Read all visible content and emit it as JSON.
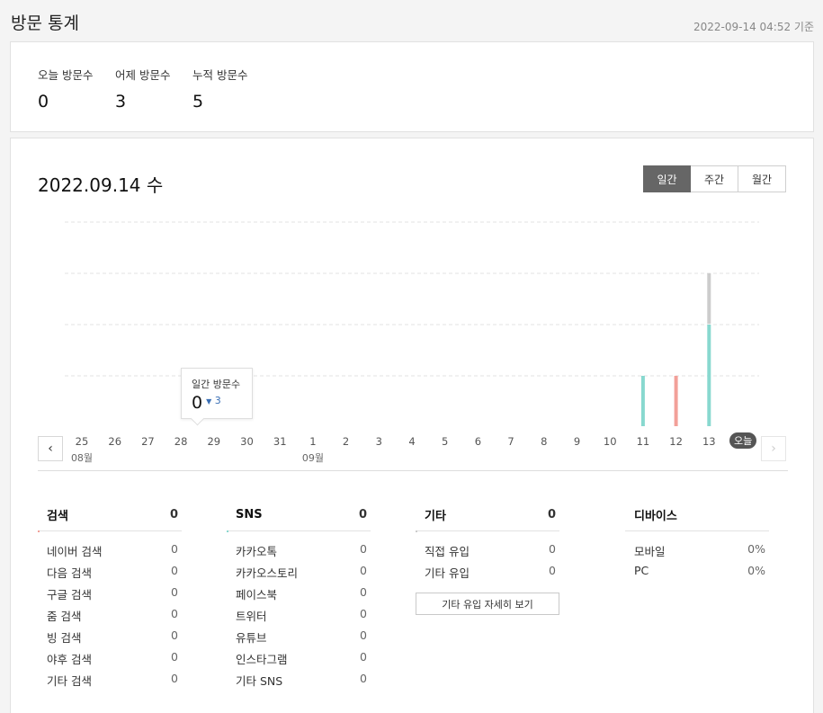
{
  "header": {
    "title": "방문 통계",
    "timestamp": "2022-09-14 04:52 기준"
  },
  "summary": [
    {
      "label": "오늘 방문수",
      "value": "0"
    },
    {
      "label": "어제 방문수",
      "value": "3"
    },
    {
      "label": "누적 방문수",
      "value": "5"
    }
  ],
  "date_title": "2022.09.14 수",
  "period_tabs": [
    {
      "label": "일간",
      "active": true
    },
    {
      "label": "주간",
      "active": false
    },
    {
      "label": "월간",
      "active": false
    }
  ],
  "tooltip": {
    "label": "일간 방문수",
    "value": "0",
    "delta": "3"
  },
  "today_badge": "오늘",
  "colors": {
    "search": "#f2a099",
    "sns": "#88d8cf",
    "other": "#cccccc",
    "accent_active": "#666666",
    "delta_blue": "#3a6fb5"
  },
  "chart_data": {
    "type": "bar",
    "stacked": true,
    "categories": [
      "25",
      "26",
      "27",
      "28",
      "29",
      "30",
      "31",
      "1",
      "2",
      "3",
      "4",
      "5",
      "6",
      "7",
      "8",
      "9",
      "10",
      "11",
      "12",
      "13"
    ],
    "month_labels": [
      {
        "at": "25",
        "label": "08월"
      },
      {
        "at": "1",
        "label": "09월"
      }
    ],
    "series": [
      {
        "name": "검색",
        "color": "#f2a099",
        "values": [
          0,
          0,
          0,
          0,
          0,
          0,
          0,
          0,
          0,
          0,
          0,
          0,
          0,
          0,
          0,
          0,
          0,
          0,
          1,
          0
        ]
      },
      {
        "name": "SNS",
        "color": "#88d8cf",
        "values": [
          0,
          0,
          0,
          0,
          0,
          0,
          0,
          0,
          0,
          0,
          0,
          0,
          0,
          0,
          0,
          0,
          0,
          1,
          0,
          2
        ]
      },
      {
        "name": "기타",
        "color": "#cccccc",
        "values": [
          0,
          0,
          0,
          0,
          0,
          0,
          0,
          0,
          0,
          0,
          0,
          0,
          0,
          0,
          0,
          0,
          0,
          0,
          0,
          1
        ]
      }
    ],
    "ylim": [
      0,
      4
    ],
    "grid": true
  },
  "stats": {
    "search": {
      "title": "검색",
      "total": "0",
      "rows": [
        {
          "label": "네이버 검색",
          "value": "0"
        },
        {
          "label": "다음 검색",
          "value": "0"
        },
        {
          "label": "구글 검색",
          "value": "0"
        },
        {
          "label": "줌 검색",
          "value": "0"
        },
        {
          "label": "빙 검색",
          "value": "0"
        },
        {
          "label": "야후 검색",
          "value": "0"
        },
        {
          "label": "기타 검색",
          "value": "0"
        }
      ]
    },
    "sns": {
      "title": "SNS",
      "total": "0",
      "rows": [
        {
          "label": "카카오톡",
          "value": "0"
        },
        {
          "label": "카카오스토리",
          "value": "0"
        },
        {
          "label": "페이스북",
          "value": "0"
        },
        {
          "label": "트위터",
          "value": "0"
        },
        {
          "label": "유튜브",
          "value": "0"
        },
        {
          "label": "인스타그램",
          "value": "0"
        },
        {
          "label": "기타 SNS",
          "value": "0"
        }
      ]
    },
    "other": {
      "title": "기타",
      "total": "0",
      "rows": [
        {
          "label": "직접 유입",
          "value": "0"
        },
        {
          "label": "기타 유입",
          "value": "0"
        }
      ],
      "detail_button": "기타 유입 자세히 보기"
    },
    "device": {
      "title": "디바이스",
      "rows": [
        {
          "label": "모바일",
          "value": "0%"
        },
        {
          "label": "PC",
          "value": "0%"
        }
      ]
    }
  }
}
